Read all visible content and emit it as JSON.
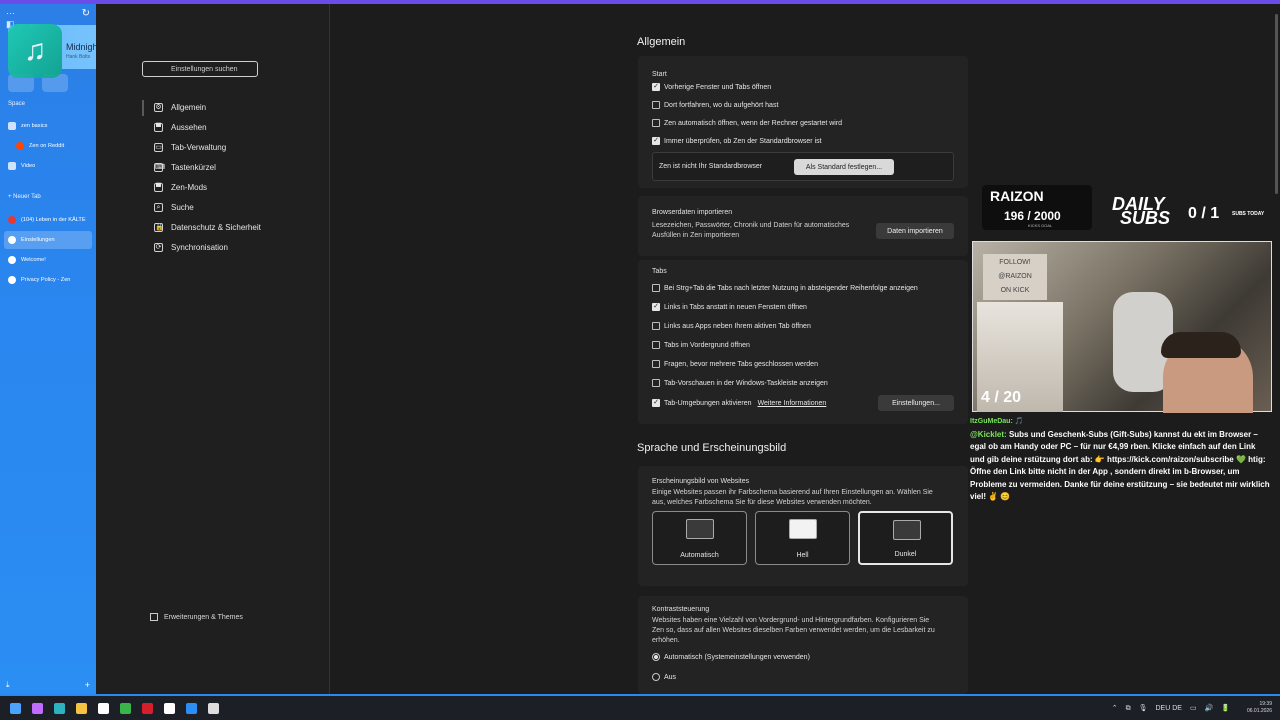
{
  "browser": {
    "toolbar_icons": [
      "⋯",
      "◧",
      "←",
      "→"
    ],
    "refresh_icon": "↻",
    "media": {
      "title": "Midnight Showdown",
      "artist": "Hank Bolts",
      "icon": "♫"
    },
    "space_label": "Space",
    "groups": [
      {
        "label": "zen basics",
        "type": "folder"
      },
      {
        "label": "Zen on Reddit",
        "type": "tab"
      },
      {
        "label": "Video",
        "type": "folder"
      }
    ],
    "new_tab": "+ Neuer Tab",
    "tabs": [
      {
        "label": "(104) Leben in der KÄLTE",
        "active": false,
        "color": "#e53935"
      },
      {
        "label": "Einstellungen",
        "active": true,
        "color": "#ffffff"
      },
      {
        "label": "Welcome!",
        "active": false,
        "color": "#ffffff"
      },
      {
        "label": "Privacy Policy - Zen",
        "active": false,
        "color": "#ffffff"
      }
    ],
    "footer_left": "⤓",
    "footer_right": "+"
  },
  "settings_nav": {
    "search_placeholder": "Einstellungen suchen",
    "items": [
      {
        "label": "Allgemein",
        "icon": "⚙"
      },
      {
        "label": "Aussehen",
        "icon": "▀"
      },
      {
        "label": "Tab-Verwaltung",
        "icon": "▭"
      },
      {
        "label": "Tastenkürzel",
        "icon": "⌨"
      },
      {
        "label": "Zen-Mods",
        "icon": "▀"
      },
      {
        "label": "Suche",
        "icon": "⌕"
      },
      {
        "label": "Datenschutz & Sicherheit",
        "icon": "🔒"
      },
      {
        "label": "Synchronisation",
        "icon": "⟳"
      }
    ],
    "extensions": "Erweiterungen & Themes"
  },
  "general": {
    "heading": "Allgemein",
    "start": {
      "title": "Start",
      "options": [
        {
          "label": "Vorherige Fenster und Tabs öffnen",
          "checked": true
        },
        {
          "label": "Dort fortfahren, wo du aufgehört hast",
          "checked": false
        },
        {
          "label": "Zen automatisch öffnen, wenn der Rechner gestartet wird",
          "checked": false
        },
        {
          "label": "Immer überprüfen, ob Zen der Standardbrowser ist",
          "checked": true
        }
      ],
      "default_notice": "Zen ist nicht Ihr Standardbrowser",
      "default_button": "Als Standard festlegen..."
    },
    "import": {
      "title": "Browserdaten importieren",
      "desc_line1": "Lesezeichen, Passwörter, Chronik und Daten für automatisches",
      "desc_line2": "Ausfüllen in Zen importieren",
      "button": "Daten importieren"
    },
    "tabs": {
      "title": "Tabs",
      "options": [
        {
          "label": "Bei Strg+Tab die Tabs nach letzter Nutzung in absteigender Reihenfolge anzeigen",
          "checked": false
        },
        {
          "label": "Links in Tabs anstatt in neuen Fenstern öffnen",
          "checked": true
        },
        {
          "label": "Links aus Apps neben Ihrem aktiven Tab öffnen",
          "checked": false
        },
        {
          "label": "Tabs im Vordergrund öffnen",
          "checked": false
        },
        {
          "label": "Fragen, bevor mehrere Tabs geschlossen werden",
          "checked": false
        },
        {
          "label": "Tab-Vorschauen in der Windows-Taskleiste anzeigen",
          "checked": false
        },
        {
          "label": "Tab-Umgebungen aktivieren",
          "checked": true
        }
      ],
      "more_info": "Weitere Informationen",
      "settings_button": "Einstellungen..."
    }
  },
  "language": {
    "heading": "Sprache und Erscheinungsbild",
    "appearance": {
      "title": "Erscheinungsbild von Websites",
      "desc_line1": "Einige Websites passen ihr Farbschema basierend auf Ihren Einstellungen an. Wählen Sie",
      "desc_line2": "aus, welches Farbschema Sie für diese Websites verwenden möchten.",
      "themes": [
        {
          "label": "Automatisch",
          "preview_color": "#3a3a3a",
          "selected": false
        },
        {
          "label": "Hell",
          "preview_color": "#f2f2f2",
          "selected": false
        },
        {
          "label": "Dunkel",
          "preview_color": "#3a3a3a",
          "selected": true
        }
      ]
    },
    "contrast": {
      "title": "Kontraststeuerung",
      "desc_line1": "Websites haben eine Vielzahl von Vordergrund- und Hintergrundfarben. Konfigurieren Sie",
      "desc_line2": "Zen so, dass auf allen Websites dieselben Farben verwendet werden, um die Lesbarkeit zu",
      "desc_line3": "erhöhen.",
      "options": [
        {
          "label": "Automatisch (Systemeinstellungen verwenden)",
          "selected": true
        },
        {
          "label": "Aus",
          "selected": false
        }
      ]
    }
  },
  "stream_overlay": {
    "brand": "RAIZON",
    "kick_count": "196  / 2000",
    "kick_goal": "KICKS GOAL",
    "daily_line1": "DAILY",
    "daily_line2": "SUBS",
    "subs_count": "0 / 1",
    "subs_today": "SUBS TODAY",
    "follow_line1": "FOLLOW!",
    "follow_line2": "@RAIZON",
    "follow_line3": "ON KICK",
    "cam_counter": "4 / 20",
    "chat_top": "ItzGuMeDau: 🎵",
    "chat_name": "@Kicklet:",
    "chat_text": "Subs und Geschenk-Subs (Gift-Subs) kannst du ekt im Browser – egal ob am Handy oder PC – für nur €4,99 rben. Klicke einfach auf den Link und gib deine rstützung dort ab: 👉 https://kick.com/raizon/subscribe 💚 htig: Öffne den Link bitte nicht in der App , sondern direkt im b-Browser, um Probleme zu vermeiden. Danke für deine erstützung – sie bedeutet mir wirklich viel! ✌️ 😊"
  },
  "taskbar": {
    "apps": [
      {
        "name": "start",
        "color": "#4aa3ff"
      },
      {
        "name": "copilot",
        "color": "#c06cff"
      },
      {
        "name": "edge",
        "color": "#2bb3c0"
      },
      {
        "name": "explorer",
        "color": "#f5c244"
      },
      {
        "name": "store",
        "color": "#ffffff"
      },
      {
        "name": "app-green",
        "color": "#39b54a"
      },
      {
        "name": "opera",
        "color": "#d61f2c"
      },
      {
        "name": "kick",
        "color": "#ffffff"
      },
      {
        "name": "stream",
        "color": "#2b8ef3"
      },
      {
        "name": "zen",
        "color": "#dddddd"
      }
    ],
    "tray_icons": [
      "⌃",
      "⧉",
      "🎙",
      "DEU DE",
      "▭",
      "🔊",
      "🔋"
    ],
    "time": "19:39",
    "date": "06.01.2026"
  }
}
